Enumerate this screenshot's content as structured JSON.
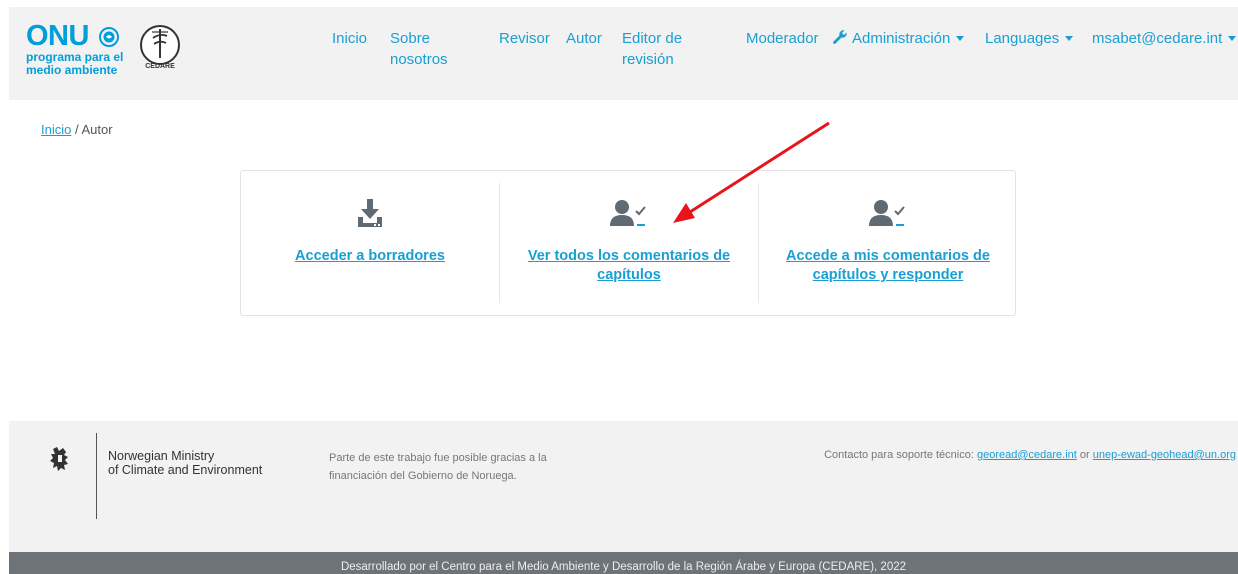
{
  "header": {
    "brand_main": "ONU",
    "brand_sub_line1": "programa para el",
    "brand_sub_line2": "medio ambiente",
    "cedare_text": "CEDARE",
    "nav": {
      "inicio": "Inicio",
      "sobre_line1": "Sobre",
      "sobre_line2": "nosotros",
      "revisor": "Revisor",
      "autor": "Autor",
      "editor_line1": "Editor de",
      "editor_line2": "revisión",
      "moderador": "Moderador",
      "administracion": "Administración",
      "languages": "Languages",
      "user": "msabet@cedare.int"
    },
    "accent": "#1a9fd3"
  },
  "breadcrumb": {
    "home": "Inicio",
    "separator": "/",
    "current": "Autor"
  },
  "actions": [
    {
      "icon": "download-icon",
      "label": "Acceder a borradores"
    },
    {
      "icon": "user-check-icon",
      "label": "Ver todos los comentarios de capítulos"
    },
    {
      "icon": "user-check-icon",
      "label": "Accede a mis comentarios de capítulos y responder"
    }
  ],
  "footer": {
    "ministry_line1": "Norwegian Ministry",
    "ministry_line2": "of Climate and Environment",
    "funding_line1": "Parte de este trabajo fue posible gracias a la",
    "funding_line2": "financiación del Gobierno de Noruega.",
    "contact_prefix": "Contacto para soporte técnico:",
    "contact_email1": "georead@cedare.int",
    "contact_or": "or",
    "contact_email2": "unep-ewad-geohead@un.org",
    "developed_by": "Desarrollado por el Centro para el Medio Ambiente y Desarrollo de la Región Árabe y Europa (CEDARE), 2022"
  },
  "annotation_color": "#e8141b"
}
